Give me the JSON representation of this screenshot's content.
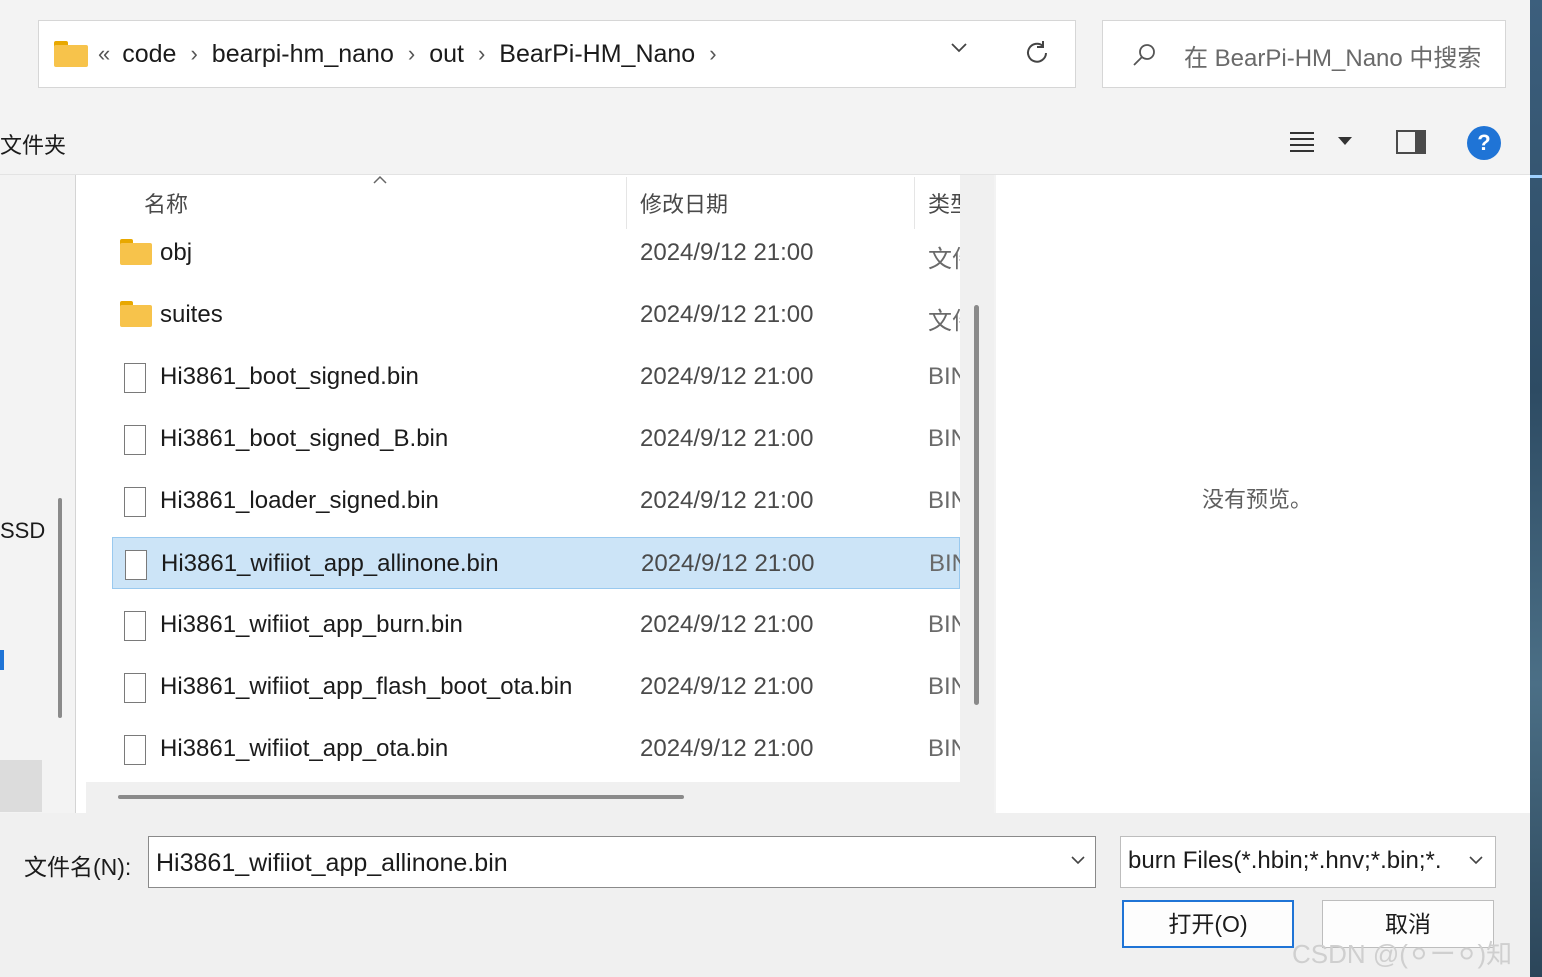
{
  "address_bar": {
    "prefix": "«",
    "crumbs": [
      "code",
      "bearpi-hm_nano",
      "out",
      "BearPi-HM_Nano"
    ],
    "separator": "›",
    "dropdown_glyph": "⌵"
  },
  "search": {
    "placeholder": "在 BearPi-HM_Nano 中搜索"
  },
  "toolbar": {
    "new_folder_label": "文件夹",
    "help_label": "?"
  },
  "left_nav": {
    "drive_label": "SSD"
  },
  "columns": {
    "name": "名称",
    "modified": "修改日期",
    "type": "类型"
  },
  "files": [
    {
      "name": "obj",
      "modified": "2024/9/12 21:00",
      "type": "文件夹",
      "icon": "folder-icon"
    },
    {
      "name": "suites",
      "modified": "2024/9/12 21:00",
      "type": "文件夹",
      "icon": "folder-icon"
    },
    {
      "name": "Hi3861_boot_signed.bin",
      "modified": "2024/9/12 21:00",
      "type": "BIN",
      "icon": "file-icon"
    },
    {
      "name": "Hi3861_boot_signed_B.bin",
      "modified": "2024/9/12 21:00",
      "type": "BIN",
      "icon": "file-icon"
    },
    {
      "name": "Hi3861_loader_signed.bin",
      "modified": "2024/9/12 21:00",
      "type": "BIN",
      "icon": "file-icon"
    },
    {
      "name": "Hi3861_wifiiot_app_allinone.bin",
      "modified": "2024/9/12 21:00",
      "type": "BIN",
      "icon": "file-icon",
      "selected": true
    },
    {
      "name": "Hi3861_wifiiot_app_burn.bin",
      "modified": "2024/9/12 21:00",
      "type": "BIN",
      "icon": "file-icon"
    },
    {
      "name": "Hi3861_wifiiot_app_flash_boot_ota.bin",
      "modified": "2024/9/12 21:00",
      "type": "BIN",
      "icon": "file-icon"
    },
    {
      "name": "Hi3861_wifiiot_app_ota.bin",
      "modified": "2024/9/12 21:00",
      "type": "BIN",
      "icon": "file-icon"
    }
  ],
  "preview": {
    "empty_text": "没有预览。"
  },
  "footer": {
    "filename_label": "文件名(N):",
    "filename_value": "Hi3861_wifiiot_app_allinone.bin",
    "filetype_value": "burn Files(*.hbin;*.hnv;*.bin;*.",
    "open_label": "打开(O)",
    "cancel_label": "取消",
    "watermark": "CSDN @(⚪ー⚪)知"
  },
  "colors": {
    "accent": "#1f74d6",
    "selection_bg": "#cce4f7",
    "selection_border": "#99c9ef",
    "folder": "#f7c34b"
  }
}
